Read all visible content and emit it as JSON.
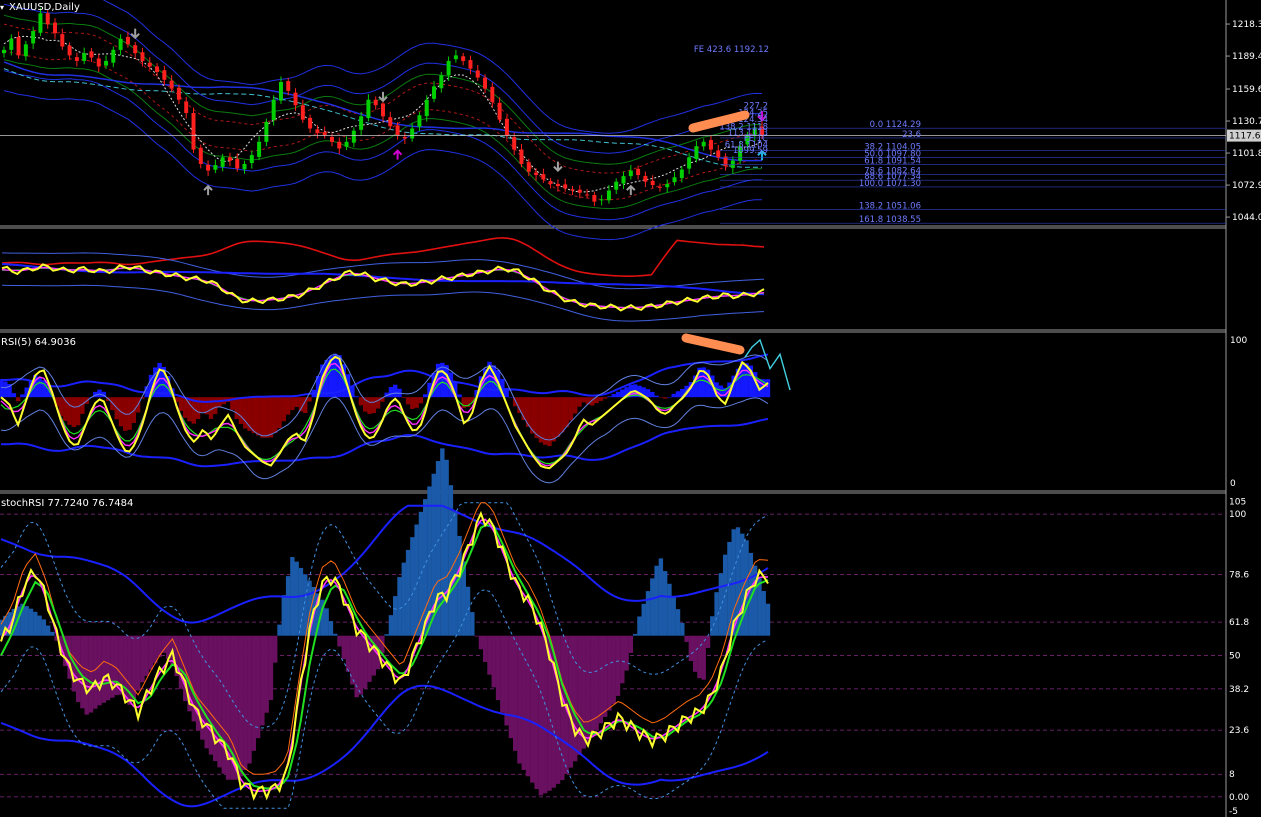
{
  "symbol_label": "XAUUSD,Daily",
  "colors": {
    "background": "#000000",
    "bull_candle": "#00d000",
    "bear_candle": "#ff2020",
    "envelope_blue": "#2030e0",
    "envelope_green": "#0a7a10",
    "envelope_red": "#b01818",
    "fib_text": "#6f7cff",
    "fast_line": "#ffff30",
    "signal_line": "#ff30ff",
    "green_line": "#20e020",
    "rsi_hist_up": "#1418ff",
    "rsi_hist_down": "#8a0000",
    "stoch_hist_up": "#1a5aa8",
    "stoch_hist_down": "#6a1060",
    "highlight": "#ff8c50",
    "current_price_line": "#c8c8c8"
  },
  "chart_data": [
    {
      "type": "candlestick",
      "title": "XAUUSD,Daily",
      "y_ticks": [
        "1218.30",
        "1189.40",
        "1159.65",
        "1130.75",
        "1101.85",
        "1072.95",
        "1044.05"
      ],
      "ylim": [
        1036,
        1240
      ],
      "current_price": "1117.60",
      "close_path": [
        1195,
        1205,
        1190,
        1200,
        1212,
        1228,
        1218,
        1210,
        1198,
        1190,
        1185,
        1192,
        1188,
        1180,
        1185,
        1195,
        1205,
        1200,
        1192,
        1185,
        1180,
        1175,
        1168,
        1160,
        1150,
        1138,
        1105,
        1092,
        1086,
        1091,
        1098,
        1095,
        1088,
        1092,
        1100,
        1112,
        1130,
        1150,
        1166,
        1158,
        1145,
        1132,
        1124,
        1120,
        1118,
        1112,
        1106,
        1112,
        1122,
        1135,
        1150,
        1145,
        1135,
        1126,
        1118,
        1115,
        1124,
        1136,
        1150,
        1162,
        1172,
        1185,
        1190,
        1185,
        1178,
        1170,
        1160,
        1148,
        1132,
        1118,
        1105,
        1092,
        1085,
        1082,
        1078,
        1074,
        1072,
        1070,
        1068,
        1066,
        1064,
        1058,
        1060,
        1068,
        1076,
        1081,
        1086,
        1082,
        1076,
        1073,
        1071,
        1074,
        1080,
        1087,
        1098,
        1108,
        1112,
        1105,
        1098,
        1090,
        1095,
        1108,
        1118,
        1125,
        1117.6
      ],
      "signal_arrows": [
        {
          "direction": "down",
          "bar": 9,
          "color": "#a0a0a0"
        },
        {
          "direction": "up",
          "bar": 14,
          "color": "#a0a0a0"
        },
        {
          "direction": "down",
          "bar": 26,
          "color": "#a0a0a0"
        },
        {
          "direction": "up",
          "bar": 27,
          "color": "#d000d0"
        },
        {
          "direction": "down",
          "bar": 38,
          "color": "#a0a0a0"
        },
        {
          "direction": "up",
          "bar": 43,
          "color": "#a0a0a0"
        },
        {
          "direction": "down",
          "bar": 52,
          "color": "#a0a0a0"
        },
        {
          "direction": "up",
          "bar": 55,
          "color": "#a0a0a0"
        },
        {
          "direction": "down",
          "bar": 62,
          "color": "#d000d0"
        },
        {
          "direction": "up",
          "bar": 81,
          "color": "#20b0e0"
        }
      ],
      "fib_levels": [
        {
          "label": "0.0 1124.29",
          "price": 1124.29
        },
        {
          "label": "23.6",
          "price": 1115.5
        },
        {
          "label": "38.2 1104.05",
          "price": 1104.05
        },
        {
          "label": "50.0 1097.80",
          "price": 1097.8
        },
        {
          "label": "61.8 1091.54",
          "price": 1091.54
        },
        {
          "label": "78.6 1082.64",
          "price": 1082.64
        },
        {
          "label": "88.6 1077.34",
          "price": 1077.34
        },
        {
          "label": "100.0 1071.30",
          "price": 1071.3
        },
        {
          "label": "138.2 1051.06",
          "price": 1051.06
        },
        {
          "label": "161.8 1038.55",
          "price": 1038.55
        }
      ],
      "fe_labels": [
        {
          "label": "FE 423.6 1192.12",
          "price": 1192.12
        },
        {
          "label": "227.2",
          "price": 1141
        },
        {
          "label": "124.25",
          "price": 1135
        },
        {
          "label": "124.34",
          "price": 1129
        },
        {
          "label": "138.2 1118",
          "price": 1122
        },
        {
          "label": "113 1113",
          "price": 1117
        },
        {
          "label": "FE 1C",
          "price": 1112
        },
        {
          "label": "61.8 1104",
          "price": 1106
        },
        {
          "label": "1099.59",
          "price": 1101
        }
      ]
    },
    {
      "type": "line",
      "title": "",
      "description_values": {
        "yellow": [
          62,
          58,
          60,
          64,
          62,
          59,
          61,
          60,
          58,
          62,
          64,
          60,
          57,
          55,
          52,
          50,
          48,
          40,
          30,
          25,
          26,
          27,
          29,
          32,
          38,
          45,
          52,
          58,
          55,
          50,
          47,
          44,
          45,
          47,
          50,
          52,
          55,
          57,
          60,
          62,
          58,
          50,
          40,
          32,
          25,
          22,
          20,
          19,
          18,
          18,
          19,
          21,
          24,
          26,
          28,
          30,
          32,
          31,
          33,
          36
        ]
      },
      "ylim": [
        0,
        100
      ]
    },
    {
      "type": "line",
      "title": "RSI(5) 64.9036",
      "y_ticks": [
        "100",
        "0"
      ],
      "ylim": [
        0,
        100
      ],
      "rsi": [
        60,
        55,
        40,
        58,
        75,
        80,
        65,
        45,
        30,
        25,
        40,
        55,
        60,
        45,
        30,
        20,
        28,
        45,
        68,
        82,
        70,
        50,
        35,
        28,
        38,
        30,
        40,
        48,
        35,
        25,
        20,
        15,
        12,
        20,
        30,
        35,
        28,
        45,
        72,
        85,
        90,
        70,
        50,
        35,
        30,
        40,
        55,
        60,
        45,
        35,
        42,
        65,
        80,
        75,
        60,
        40,
        50,
        72,
        82,
        70,
        55,
        40,
        30,
        20,
        12,
        10,
        15,
        20,
        30,
        45,
        40,
        45,
        50,
        55,
        60,
        65,
        62,
        58,
        50,
        48,
        55,
        60,
        68,
        80,
        75,
        60,
        55,
        72,
        85,
        78,
        65,
        70
      ],
      "hist": [
        20,
        15,
        -5,
        10,
        25,
        20,
        5,
        -20,
        -30,
        -35,
        -10,
        5,
        10,
        -10,
        -30,
        -40,
        -25,
        5,
        30,
        40,
        20,
        -10,
        -25,
        -30,
        -15,
        -25,
        -10,
        -5,
        -25,
        -35,
        -40,
        -45,
        -45,
        -35,
        -20,
        -10,
        -20,
        5,
        35,
        45,
        50,
        30,
        5,
        -15,
        -20,
        -10,
        10,
        15,
        -5,
        -15,
        -5,
        20,
        40,
        35,
        15,
        -15,
        -5,
        25,
        40,
        30,
        10,
        -10,
        -25,
        -40,
        -50,
        -55,
        -45,
        -35,
        -20,
        -5,
        -10,
        -5,
        0,
        5,
        10,
        15,
        12,
        8,
        0,
        -2,
        5,
        10,
        18,
        35,
        30,
        15,
        10,
        25,
        40,
        35,
        20,
        20
      ]
    },
    {
      "type": "line",
      "title": "stochRSI 77.7240 76.7484",
      "y_ticks": [
        "105",
        "100",
        "78.6",
        "61.8",
        "50",
        "38.2",
        "23.6",
        "8",
        "0.00",
        "-5"
      ],
      "ylim": [
        -5,
        105
      ],
      "stoch_k": [
        55,
        62,
        75,
        80,
        70,
        55,
        45,
        40,
        38,
        42,
        40,
        35,
        30,
        38,
        45,
        50,
        40,
        30,
        25,
        20,
        15,
        5,
        2,
        2,
        3,
        8,
        35,
        60,
        75,
        78,
        70,
        60,
        55,
        50,
        45,
        40,
        50,
        60,
        70,
        72,
        80,
        90,
        100,
        95,
        85,
        75,
        70,
        62,
        50,
        35,
        25,
        20,
        22,
        25,
        28,
        25,
        22,
        20,
        22,
        25,
        28,
        30,
        35,
        45,
        60,
        70,
        78,
        77.7
      ],
      "stoch_d": [
        50,
        58,
        68,
        76,
        73,
        62,
        50,
        43,
        40,
        40,
        41,
        38,
        33,
        35,
        42,
        47,
        44,
        35,
        28,
        22,
        17,
        9,
        4,
        3,
        3,
        6,
        22,
        48,
        66,
        75,
        73,
        64,
        57,
        52,
        47,
        43,
        47,
        56,
        66,
        71,
        77,
        86,
        96,
        96,
        88,
        79,
        72,
        65,
        55,
        40,
        30,
        23,
        22,
        24,
        27,
        26,
        24,
        21,
        21,
        24,
        27,
        29,
        33,
        41,
        55,
        66,
        75,
        76.7
      ],
      "hist": [
        5,
        8,
        10,
        8,
        5,
        0,
        -10,
        -20,
        -25,
        -22,
        -20,
        -18,
        -22,
        -15,
        -10,
        -5,
        -10,
        -20,
        -28,
        -35,
        -40,
        -45,
        -45,
        -40,
        -30,
        -20,
        10,
        25,
        20,
        15,
        10,
        0,
        -10,
        -20,
        -15,
        -10,
        5,
        20,
        30,
        40,
        50,
        60,
        40,
        20,
        0,
        -10,
        -20,
        -30,
        -40,
        -45,
        -50,
        -48,
        -45,
        -40,
        -35,
        -30,
        -25,
        -20,
        -10,
        5,
        15,
        25,
        15,
        5,
        -10,
        -15,
        10,
        25,
        35,
        30,
        20,
        10
      ]
    }
  ]
}
